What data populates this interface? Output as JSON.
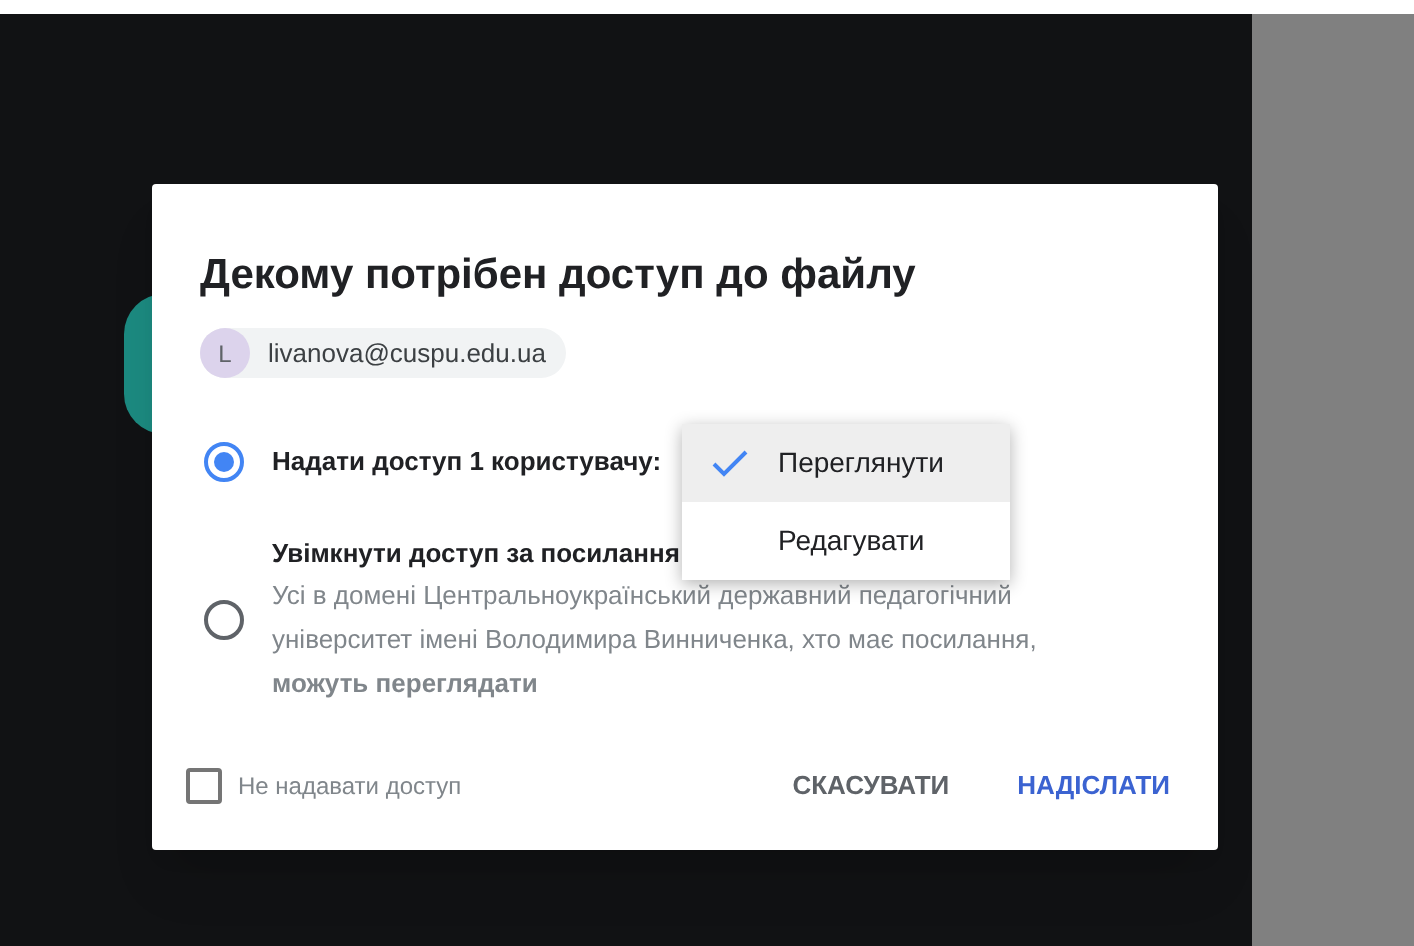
{
  "dialog": {
    "title": "Декому потрібен доступ до файлу",
    "recipient": {
      "initial": "L",
      "email": "livanova@cuspu.edu.ua"
    },
    "options": [
      {
        "label": "Надати доступ 1 користувачу:",
        "selected": true
      },
      {
        "label": "Увімкнути доступ за посилання",
        "description": "Усі в домені Центральноукраїнський державний педагогічний університет імені Володимира Винниченка, хто має посилання, **можуть переглядати**",
        "selected": false
      }
    ],
    "menu": [
      {
        "label": "Переглянути",
        "selected": true
      },
      {
        "label": "Редагувати",
        "selected": false
      }
    ],
    "no_access": {
      "label": "Не надавати доступ",
      "checked": false
    },
    "buttons": [
      {
        "label": "СКАСУВАТИ",
        "kind": "secondary"
      },
      {
        "label": "НАДІСЛАТИ",
        "kind": "primary"
      }
    ]
  }
}
